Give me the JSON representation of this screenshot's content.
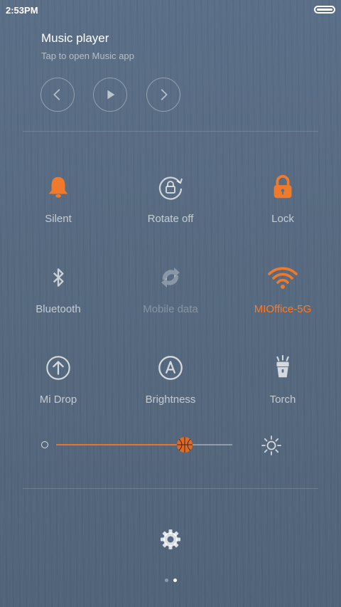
{
  "status_bar": {
    "time": "2:53PM"
  },
  "music": {
    "title": "Music player",
    "subtitle": "Tap to open Music app",
    "controls": [
      "previous",
      "play",
      "next"
    ]
  },
  "toggles": [
    {
      "label": "Silent",
      "icon": "bell-icon",
      "state": "on"
    },
    {
      "label": "Rotate off",
      "icon": "rotate-lock-icon",
      "state": "off"
    },
    {
      "label": "Lock",
      "icon": "lock-icon",
      "state": "on"
    },
    {
      "label": "Bluetooth",
      "icon": "bluetooth-icon",
      "state": "off"
    },
    {
      "label": "Mobile data",
      "icon": "mobile-data-icon",
      "state": "disabled"
    },
    {
      "label": "MIOffice-5G",
      "icon": "wifi-icon",
      "state": "on"
    },
    {
      "label": "Mi Drop",
      "icon": "mi-drop-icon",
      "state": "off"
    },
    {
      "label": "Brightness",
      "icon": "auto-brightness-icon",
      "state": "off"
    },
    {
      "label": "Torch",
      "icon": "torch-icon",
      "state": "off"
    }
  ],
  "brightness": {
    "level": 0.73
  },
  "pager": {
    "count": 2,
    "active": 1
  },
  "colors": {
    "accent": "#ff7a22",
    "background": "#566a82",
    "inactive": "#ffffffa6"
  }
}
